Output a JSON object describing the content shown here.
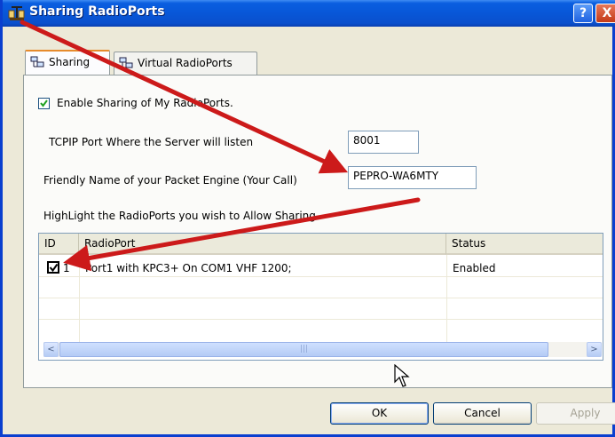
{
  "window": {
    "title": "Sharing RadioPorts",
    "help_label": "?",
    "close_label": "X",
    "app_icon": "network-antenna-icon"
  },
  "tabs": [
    {
      "label": "Sharing",
      "icon": "network-computers-icon",
      "active": true
    },
    {
      "label": "Virtual RadioPorts",
      "icon": "network-computers-icon",
      "active": false
    }
  ],
  "sharing": {
    "enable_label": "Enable Sharing of My RadioPorts.",
    "enable_checked": true,
    "tcpip_label": "TCPIP Port Where the Server will listen",
    "tcpip_value": "8001",
    "friendly_label": "Friendly Name of your Packet Engine (Your Call)",
    "friendly_value": "PEPRO-WA6MTY",
    "highlight_label": "HighLight the RadioPorts you wish to Allow Sharing"
  },
  "grid": {
    "columns": [
      "ID",
      "RadioPort",
      "Status"
    ],
    "rows": [
      {
        "checked": true,
        "id": "1",
        "radioport": "Port1 with KPC3+ On COM1 VHF 1200;",
        "status": "Enabled"
      }
    ],
    "scroll_left": "<",
    "scroll_right": ">",
    "thumb_grip": "|||"
  },
  "buttons": {
    "ok": "OK",
    "cancel": "Cancel",
    "apply": "Apply"
  },
  "colors": {
    "title_blue": "#0a5ee0",
    "arrow_red": "#cc1a1a",
    "dialog_bg": "#ece9d8"
  }
}
